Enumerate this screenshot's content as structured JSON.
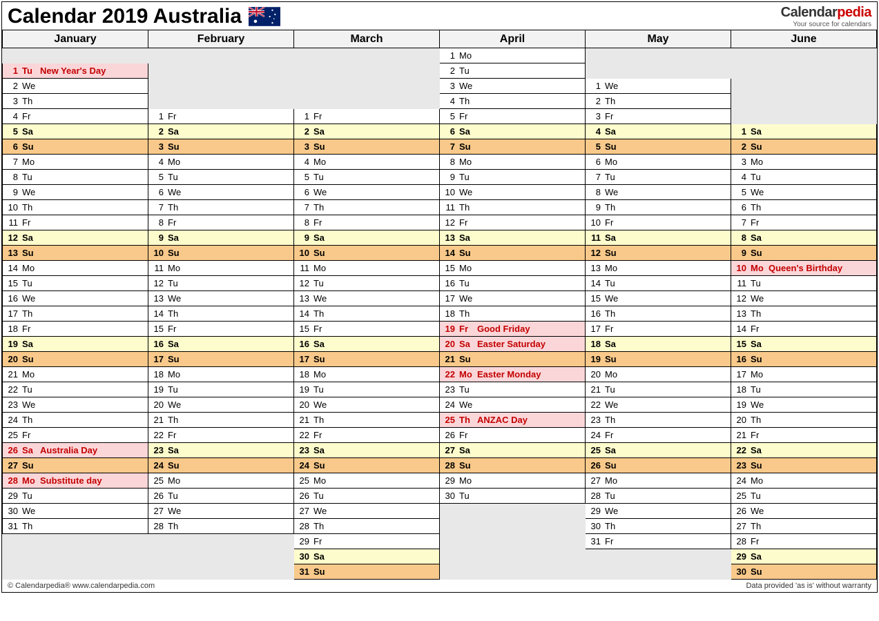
{
  "title": "Calendar 2019 Australia",
  "logo": {
    "main1": "Calendar",
    "main2": "pedia",
    "sub": "Your source for calendars"
  },
  "footer_left": "© Calendarpedia®   www.calendarpedia.com",
  "footer_right": "Data provided 'as is' without warranty",
  "months": [
    "January",
    "February",
    "March",
    "April",
    "May",
    "June"
  ],
  "chart_data": {
    "type": "table",
    "description": "Monthly calendar Jan–Jun 2019 Australia; rows align same weekday across months; 'h'=public holiday, 's'=Saturday (yellow), 'u'=Sunday (orange).",
    "rows": [
      [
        null,
        null,
        null,
        {
          "d": 1,
          "wd": "Mo"
        },
        null,
        null
      ],
      [
        {
          "d": 1,
          "wd": "Tu",
          "t": "h",
          "ev": "New Year's Day"
        },
        null,
        null,
        {
          "d": 2,
          "wd": "Tu"
        },
        null,
        null
      ],
      [
        {
          "d": 2,
          "wd": "We"
        },
        null,
        null,
        {
          "d": 3,
          "wd": "We"
        },
        {
          "d": 1,
          "wd": "We"
        },
        null
      ],
      [
        {
          "d": 3,
          "wd": "Th"
        },
        null,
        null,
        {
          "d": 4,
          "wd": "Th"
        },
        {
          "d": 2,
          "wd": "Th"
        },
        null
      ],
      [
        {
          "d": 4,
          "wd": "Fr"
        },
        {
          "d": 1,
          "wd": "Fr"
        },
        {
          "d": 1,
          "wd": "Fr"
        },
        {
          "d": 5,
          "wd": "Fr"
        },
        {
          "d": 3,
          "wd": "Fr"
        },
        null
      ],
      [
        {
          "d": 5,
          "wd": "Sa",
          "t": "s"
        },
        {
          "d": 2,
          "wd": "Sa",
          "t": "s"
        },
        {
          "d": 2,
          "wd": "Sa",
          "t": "s"
        },
        {
          "d": 6,
          "wd": "Sa",
          "t": "s"
        },
        {
          "d": 4,
          "wd": "Sa",
          "t": "s"
        },
        {
          "d": 1,
          "wd": "Sa",
          "t": "s"
        }
      ],
      [
        {
          "d": 6,
          "wd": "Su",
          "t": "u"
        },
        {
          "d": 3,
          "wd": "Su",
          "t": "u"
        },
        {
          "d": 3,
          "wd": "Su",
          "t": "u"
        },
        {
          "d": 7,
          "wd": "Su",
          "t": "u"
        },
        {
          "d": 5,
          "wd": "Su",
          "t": "u"
        },
        {
          "d": 2,
          "wd": "Su",
          "t": "u"
        }
      ],
      [
        {
          "d": 7,
          "wd": "Mo"
        },
        {
          "d": 4,
          "wd": "Mo"
        },
        {
          "d": 4,
          "wd": "Mo"
        },
        {
          "d": 8,
          "wd": "Mo"
        },
        {
          "d": 6,
          "wd": "Mo"
        },
        {
          "d": 3,
          "wd": "Mo"
        }
      ],
      [
        {
          "d": 8,
          "wd": "Tu"
        },
        {
          "d": 5,
          "wd": "Tu"
        },
        {
          "d": 5,
          "wd": "Tu"
        },
        {
          "d": 9,
          "wd": "Tu"
        },
        {
          "d": 7,
          "wd": "Tu"
        },
        {
          "d": 4,
          "wd": "Tu"
        }
      ],
      [
        {
          "d": 9,
          "wd": "We"
        },
        {
          "d": 6,
          "wd": "We"
        },
        {
          "d": 6,
          "wd": "We"
        },
        {
          "d": 10,
          "wd": "We"
        },
        {
          "d": 8,
          "wd": "We"
        },
        {
          "d": 5,
          "wd": "We"
        }
      ],
      [
        {
          "d": 10,
          "wd": "Th"
        },
        {
          "d": 7,
          "wd": "Th"
        },
        {
          "d": 7,
          "wd": "Th"
        },
        {
          "d": 11,
          "wd": "Th"
        },
        {
          "d": 9,
          "wd": "Th"
        },
        {
          "d": 6,
          "wd": "Th"
        }
      ],
      [
        {
          "d": 11,
          "wd": "Fr"
        },
        {
          "d": 8,
          "wd": "Fr"
        },
        {
          "d": 8,
          "wd": "Fr"
        },
        {
          "d": 12,
          "wd": "Fr"
        },
        {
          "d": 10,
          "wd": "Fr"
        },
        {
          "d": 7,
          "wd": "Fr"
        }
      ],
      [
        {
          "d": 12,
          "wd": "Sa",
          "t": "s"
        },
        {
          "d": 9,
          "wd": "Sa",
          "t": "s"
        },
        {
          "d": 9,
          "wd": "Sa",
          "t": "s"
        },
        {
          "d": 13,
          "wd": "Sa",
          "t": "s"
        },
        {
          "d": 11,
          "wd": "Sa",
          "t": "s"
        },
        {
          "d": 8,
          "wd": "Sa",
          "t": "s"
        }
      ],
      [
        {
          "d": 13,
          "wd": "Su",
          "t": "u"
        },
        {
          "d": 10,
          "wd": "Su",
          "t": "u"
        },
        {
          "d": 10,
          "wd": "Su",
          "t": "u"
        },
        {
          "d": 14,
          "wd": "Su",
          "t": "u"
        },
        {
          "d": 12,
          "wd": "Su",
          "t": "u"
        },
        {
          "d": 9,
          "wd": "Su",
          "t": "u"
        }
      ],
      [
        {
          "d": 14,
          "wd": "Mo"
        },
        {
          "d": 11,
          "wd": "Mo"
        },
        {
          "d": 11,
          "wd": "Mo"
        },
        {
          "d": 15,
          "wd": "Mo"
        },
        {
          "d": 13,
          "wd": "Mo"
        },
        {
          "d": 10,
          "wd": "Mo",
          "t": "h",
          "ev": "Queen's Birthday"
        }
      ],
      [
        {
          "d": 15,
          "wd": "Tu"
        },
        {
          "d": 12,
          "wd": "Tu"
        },
        {
          "d": 12,
          "wd": "Tu"
        },
        {
          "d": 16,
          "wd": "Tu"
        },
        {
          "d": 14,
          "wd": "Tu"
        },
        {
          "d": 11,
          "wd": "Tu"
        }
      ],
      [
        {
          "d": 16,
          "wd": "We"
        },
        {
          "d": 13,
          "wd": "We"
        },
        {
          "d": 13,
          "wd": "We"
        },
        {
          "d": 17,
          "wd": "We"
        },
        {
          "d": 15,
          "wd": "We"
        },
        {
          "d": 12,
          "wd": "We"
        }
      ],
      [
        {
          "d": 17,
          "wd": "Th"
        },
        {
          "d": 14,
          "wd": "Th"
        },
        {
          "d": 14,
          "wd": "Th"
        },
        {
          "d": 18,
          "wd": "Th"
        },
        {
          "d": 16,
          "wd": "Th"
        },
        {
          "d": 13,
          "wd": "Th"
        }
      ],
      [
        {
          "d": 18,
          "wd": "Fr"
        },
        {
          "d": 15,
          "wd": "Fr"
        },
        {
          "d": 15,
          "wd": "Fr"
        },
        {
          "d": 19,
          "wd": "Fr",
          "t": "h",
          "ev": "Good Friday"
        },
        {
          "d": 17,
          "wd": "Fr"
        },
        {
          "d": 14,
          "wd": "Fr"
        }
      ],
      [
        {
          "d": 19,
          "wd": "Sa",
          "t": "s"
        },
        {
          "d": 16,
          "wd": "Sa",
          "t": "s"
        },
        {
          "d": 16,
          "wd": "Sa",
          "t": "s"
        },
        {
          "d": 20,
          "wd": "Sa",
          "t": "h",
          "ev": "Easter Saturday"
        },
        {
          "d": 18,
          "wd": "Sa",
          "t": "s"
        },
        {
          "d": 15,
          "wd": "Sa",
          "t": "s"
        }
      ],
      [
        {
          "d": 20,
          "wd": "Su",
          "t": "u"
        },
        {
          "d": 17,
          "wd": "Su",
          "t": "u"
        },
        {
          "d": 17,
          "wd": "Su",
          "t": "u"
        },
        {
          "d": 21,
          "wd": "Su",
          "t": "u"
        },
        {
          "d": 19,
          "wd": "Su",
          "t": "u"
        },
        {
          "d": 16,
          "wd": "Su",
          "t": "u"
        }
      ],
      [
        {
          "d": 21,
          "wd": "Mo"
        },
        {
          "d": 18,
          "wd": "Mo"
        },
        {
          "d": 18,
          "wd": "Mo"
        },
        {
          "d": 22,
          "wd": "Mo",
          "t": "h",
          "ev": "Easter Monday"
        },
        {
          "d": 20,
          "wd": "Mo"
        },
        {
          "d": 17,
          "wd": "Mo"
        }
      ],
      [
        {
          "d": 22,
          "wd": "Tu"
        },
        {
          "d": 19,
          "wd": "Tu"
        },
        {
          "d": 19,
          "wd": "Tu"
        },
        {
          "d": 23,
          "wd": "Tu"
        },
        {
          "d": 21,
          "wd": "Tu"
        },
        {
          "d": 18,
          "wd": "Tu"
        }
      ],
      [
        {
          "d": 23,
          "wd": "We"
        },
        {
          "d": 20,
          "wd": "We"
        },
        {
          "d": 20,
          "wd": "We"
        },
        {
          "d": 24,
          "wd": "We"
        },
        {
          "d": 22,
          "wd": "We"
        },
        {
          "d": 19,
          "wd": "We"
        }
      ],
      [
        {
          "d": 24,
          "wd": "Th"
        },
        {
          "d": 21,
          "wd": "Th"
        },
        {
          "d": 21,
          "wd": "Th"
        },
        {
          "d": 25,
          "wd": "Th",
          "t": "h",
          "ev": "ANZAC Day"
        },
        {
          "d": 23,
          "wd": "Th"
        },
        {
          "d": 20,
          "wd": "Th"
        }
      ],
      [
        {
          "d": 25,
          "wd": "Fr"
        },
        {
          "d": 22,
          "wd": "Fr"
        },
        {
          "d": 22,
          "wd": "Fr"
        },
        {
          "d": 26,
          "wd": "Fr"
        },
        {
          "d": 24,
          "wd": "Fr"
        },
        {
          "d": 21,
          "wd": "Fr"
        }
      ],
      [
        {
          "d": 26,
          "wd": "Sa",
          "t": "h",
          "ev": "Australia Day"
        },
        {
          "d": 23,
          "wd": "Sa",
          "t": "s"
        },
        {
          "d": 23,
          "wd": "Sa",
          "t": "s"
        },
        {
          "d": 27,
          "wd": "Sa",
          "t": "s"
        },
        {
          "d": 25,
          "wd": "Sa",
          "t": "s"
        },
        {
          "d": 22,
          "wd": "Sa",
          "t": "s"
        }
      ],
      [
        {
          "d": 27,
          "wd": "Su",
          "t": "u"
        },
        {
          "d": 24,
          "wd": "Su",
          "t": "u"
        },
        {
          "d": 24,
          "wd": "Su",
          "t": "u"
        },
        {
          "d": 28,
          "wd": "Su",
          "t": "u"
        },
        {
          "d": 26,
          "wd": "Su",
          "t": "u"
        },
        {
          "d": 23,
          "wd": "Su",
          "t": "u"
        }
      ],
      [
        {
          "d": 28,
          "wd": "Mo",
          "t": "h",
          "ev": "Substitute day"
        },
        {
          "d": 25,
          "wd": "Mo"
        },
        {
          "d": 25,
          "wd": "Mo"
        },
        {
          "d": 29,
          "wd": "Mo"
        },
        {
          "d": 27,
          "wd": "Mo"
        },
        {
          "d": 24,
          "wd": "Mo"
        }
      ],
      [
        {
          "d": 29,
          "wd": "Tu"
        },
        {
          "d": 26,
          "wd": "Tu"
        },
        {
          "d": 26,
          "wd": "Tu"
        },
        {
          "d": 30,
          "wd": "Tu"
        },
        {
          "d": 28,
          "wd": "Tu"
        },
        {
          "d": 25,
          "wd": "Tu"
        }
      ],
      [
        {
          "d": 30,
          "wd": "We"
        },
        {
          "d": 27,
          "wd": "We"
        },
        {
          "d": 27,
          "wd": "We"
        },
        null,
        {
          "d": 29,
          "wd": "We"
        },
        {
          "d": 26,
          "wd": "We"
        }
      ],
      [
        {
          "d": 31,
          "wd": "Th"
        },
        {
          "d": 28,
          "wd": "Th"
        },
        {
          "d": 28,
          "wd": "Th"
        },
        null,
        {
          "d": 30,
          "wd": "Th"
        },
        {
          "d": 27,
          "wd": "Th"
        }
      ],
      [
        null,
        null,
        {
          "d": 29,
          "wd": "Fr"
        },
        null,
        {
          "d": 31,
          "wd": "Fr"
        },
        {
          "d": 28,
          "wd": "Fr"
        }
      ],
      [
        null,
        null,
        {
          "d": 30,
          "wd": "Sa",
          "t": "s"
        },
        null,
        null,
        {
          "d": 29,
          "wd": "Sa",
          "t": "s"
        }
      ],
      [
        null,
        null,
        {
          "d": 31,
          "wd": "Su",
          "t": "u"
        },
        null,
        null,
        {
          "d": 30,
          "wd": "Su",
          "t": "u"
        }
      ]
    ]
  }
}
